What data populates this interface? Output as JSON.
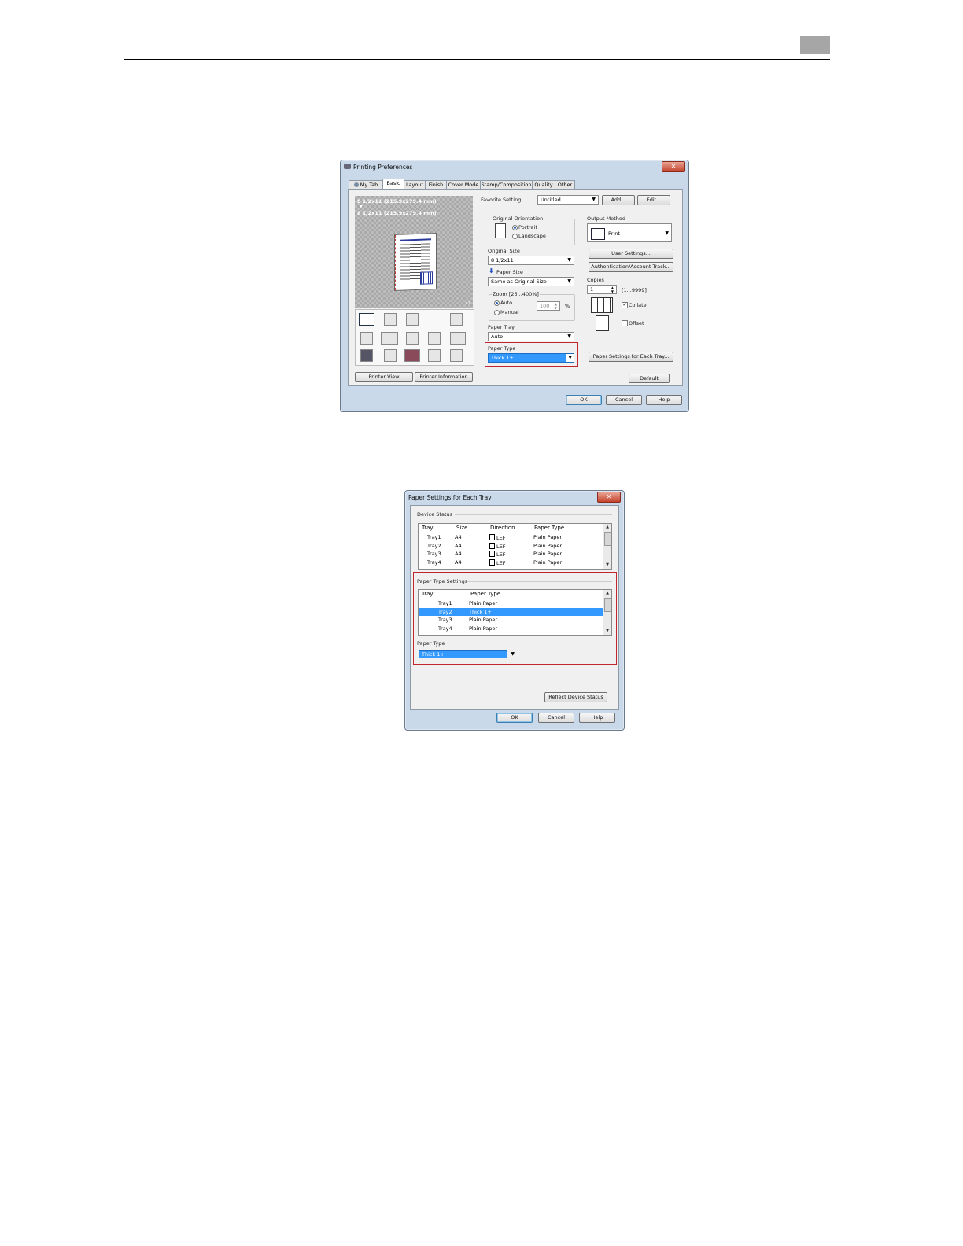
{
  "page": {
    "chapter_number": ""
  },
  "printing_preferences": {
    "title": "Printing Preferences",
    "close_glyph": "✕",
    "tabs": [
      "My Tab",
      "Basic",
      "Layout",
      "Finish",
      "Cover Mode",
      "Stamp/Composition",
      "Quality",
      "Other"
    ],
    "active_tab": "Basic",
    "preview_text_line1": "8 1/2x11 (215.9x279.4 mm)",
    "preview_arrow": "▼",
    "preview_text_line2": "8 1/2x11 (215.9x279.4 mm)",
    "preview_copies": "x1",
    "printer_view_button": "Printer View",
    "printer_information_button": "Printer Information",
    "favorite_setting_label": "Favorite Setting",
    "favorite_setting_value": "Untitled",
    "add_button": "Add...",
    "edit_button": "Edit...",
    "original_orientation_label": "Original Orientation",
    "portrait_label": "Portrait",
    "landscape_label": "Landscape",
    "original_size_label": "Original Size",
    "original_size_value": "8 1/2x11",
    "paper_size_label": "Paper Size",
    "paper_size_value": "Same as Original Size",
    "zoom_label": "Zoom [25...400%]",
    "zoom_auto": "Auto",
    "zoom_manual": "Manual",
    "zoom_value": "100",
    "zoom_unit": "%",
    "paper_tray_label": "Paper Tray",
    "paper_tray_value": "Auto",
    "paper_type_label": "Paper Type",
    "paper_type_value": "Thick 1+",
    "output_method_label": "Output Method",
    "output_method_value": "Print",
    "user_settings_button": "User Settings...",
    "authentication_button": "Authentication/Account Track...",
    "copies_label": "Copies",
    "copies_value": "1",
    "copies_range": "[1...9999]",
    "collate_label": "Collate",
    "offset_label": "Offset",
    "paper_settings_button": "Paper Settings for Each Tray...",
    "default_button": "Default",
    "ok_button": "OK",
    "cancel_button": "Cancel",
    "help_button": "Help"
  },
  "paper_settings": {
    "title": "Paper Settings for Each Tray",
    "close_glyph": "✕",
    "device_status_label": "Device Status",
    "device_columns": [
      "Tray",
      "Size",
      "Direction",
      "Paper Type"
    ],
    "device_rows": [
      [
        "Tray1",
        "A4",
        "LEF",
        "Plain Paper"
      ],
      [
        "Tray2",
        "A4",
        "LEF",
        "Plain Paper"
      ],
      [
        "Tray3",
        "A4",
        "LEF",
        "Plain Paper"
      ],
      [
        "Tray4",
        "A4",
        "LEF",
        "Plain Paper"
      ]
    ],
    "paper_type_settings_label": "Paper Type Settings",
    "type_columns": [
      "Tray",
      "Paper Type"
    ],
    "type_rows": [
      [
        "Tray1",
        "Plain Paper"
      ],
      [
        "Tray2",
        "Thick 1+"
      ],
      [
        "Tray3",
        "Plain Paper"
      ],
      [
        "Tray4",
        "Plain Paper"
      ]
    ],
    "selected_row": 1,
    "paper_type_label": "Paper Type",
    "paper_type_value": "Thick 1+",
    "reflect_button": "Reflect Device Status",
    "ok_button": "OK",
    "cancel_button": "Cancel",
    "help_button": "Help"
  },
  "colors": {
    "highlight": "#3399ff",
    "callout": "#c0272d"
  }
}
